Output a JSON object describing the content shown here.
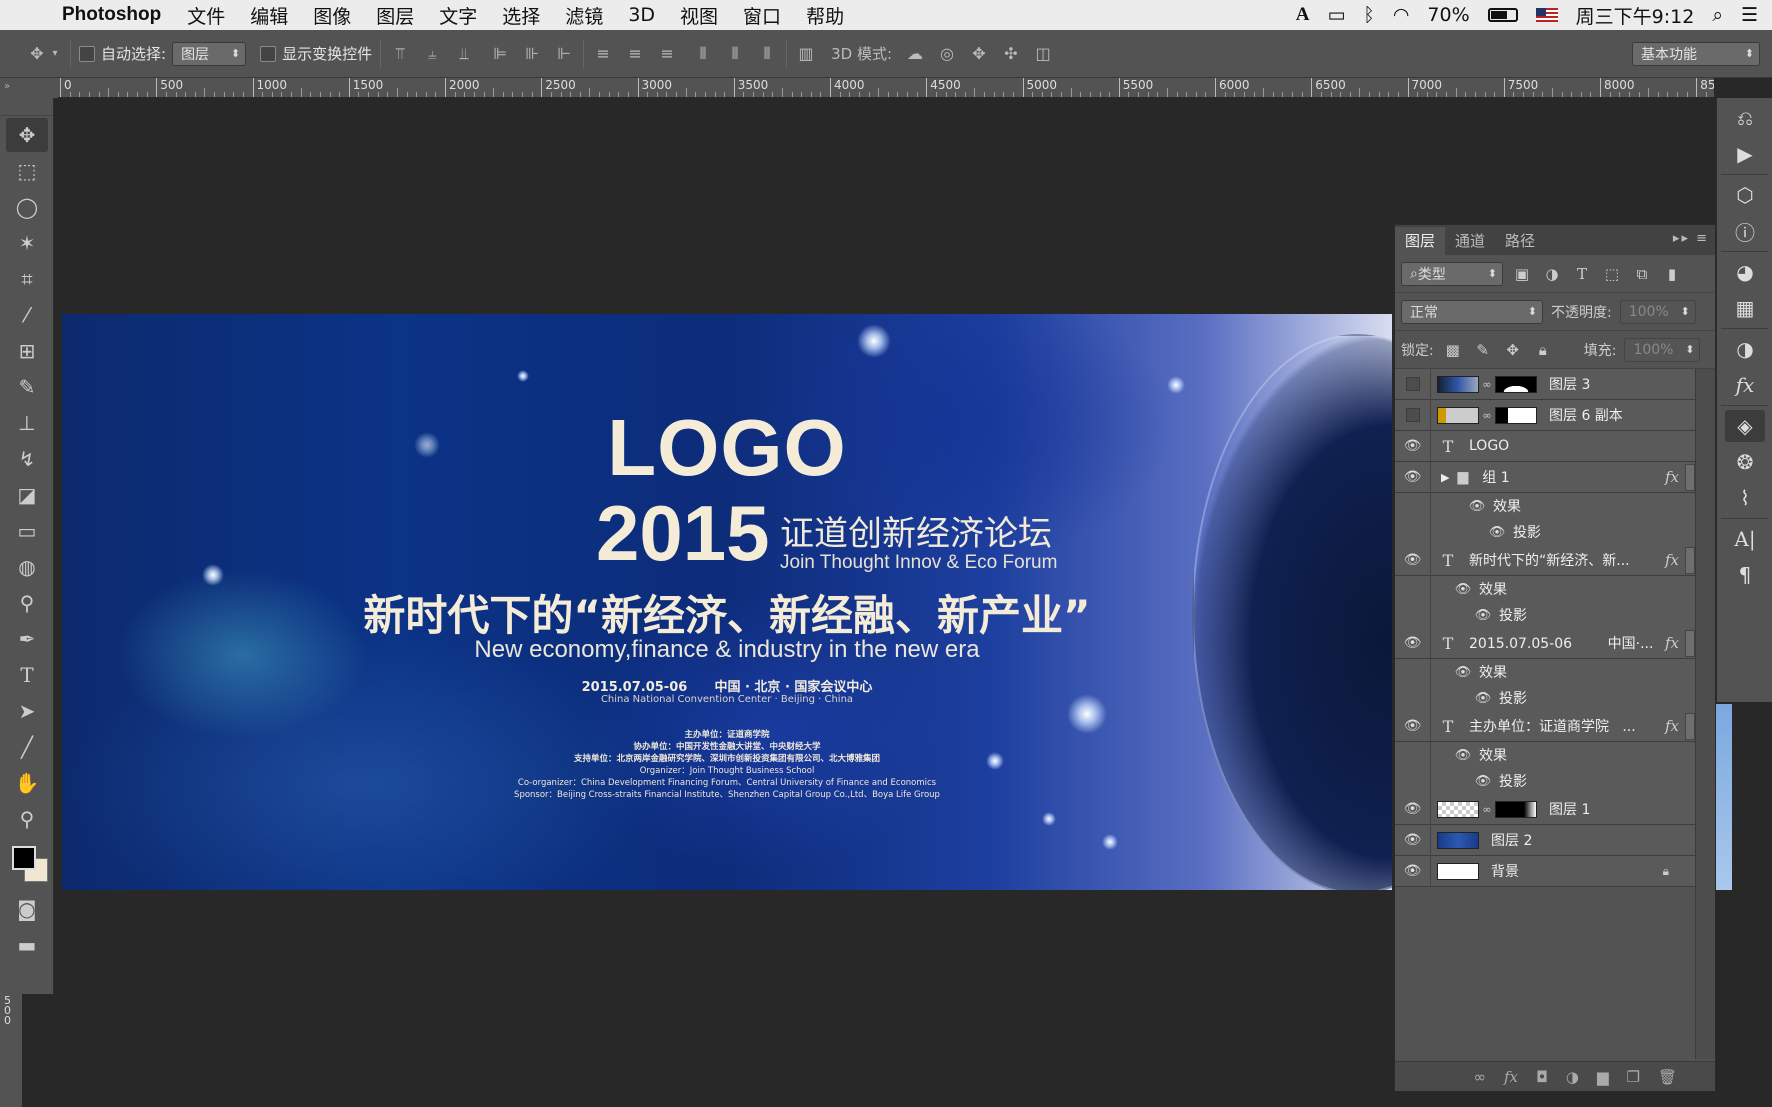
{
  "menubar": {
    "apple": "",
    "app_name": "Photoshop",
    "items": [
      "文件",
      "编辑",
      "图像",
      "图层",
      "文字",
      "选择",
      "滤镜",
      "3D",
      "视图",
      "窗口",
      "帮助"
    ],
    "adobe_badge": "A",
    "battery_percent": "70%",
    "battery_level": 0.7,
    "clock": "周三下午9:12"
  },
  "options": {
    "auto_select_label": "自动选择:",
    "auto_select_value": "图层",
    "show_transform_label": "显示变换控件",
    "mode_3d_label": "3D 模式:",
    "workspace": "基本功能"
  },
  "ruler": {
    "labels": [
      "0",
      "500",
      "1000",
      "1500",
      "2000",
      "2500",
      "3000",
      "3500",
      "4000",
      "4500",
      "5000",
      "5500",
      "6000",
      "6500",
      "7000",
      "7500",
      "8000",
      "850"
    ],
    "left_label": "500"
  },
  "banner": {
    "logo": "LOGO",
    "year": "2015",
    "forum_cn": "证道创新经济论坛",
    "forum_en": "Join Thought Innov & Eco Forum",
    "slogan_cn": "新时代下的“新经济、新经融、新产业”",
    "slogan_en": "New economy,finance & industry in the new era",
    "date_venue": "2015.07.05-06      中国 · 北京 · 国家会议中心",
    "venue_en": "China National Convention Center · Beijing · China",
    "host": "主办单位：证道商学院",
    "coorganizer": "协办单位：中国开发性金融大讲堂、中央财经大学",
    "supporters": "支持单位：北京两岸金融研究学院、深圳市创新投资集团有限公司、北大博雅集团",
    "organizer_en": "Organizer：Join Thought Business School",
    "coorganizer_en": "Co-organizer：China Development Financing Forum、Central University of Finance and Economics",
    "sponsor_en": "Sponsor：Beijing Cross-straits Financial Institute、Shenzhen Capital Group Co.,Ltd、Boya Life Group"
  },
  "layers_panel": {
    "tabs": [
      "图层",
      "通道",
      "路径"
    ],
    "filter_kind": "类型",
    "blend_mode": "正常",
    "opacity_label": "不透明度:",
    "opacity_value": "100%",
    "lock_label": "锁定:",
    "fill_label": "填充:",
    "fill_value": "100%",
    "layers": {
      "l3": "图层 3",
      "l6copy": "图层 6 副本",
      "logo": "LOGO",
      "group1": "组 1",
      "effects": "效果",
      "shadow": "投影",
      "text_slogan": "新时代下的“新经济、新...",
      "text_date": "2015.07.05-06        中国·...",
      "text_host": "主办单位：证道商学院   ...",
      "l1": "图层 1",
      "l2": "图层 2",
      "bg": "背景"
    },
    "fx_label": "fx",
    "text_icon": "T"
  }
}
